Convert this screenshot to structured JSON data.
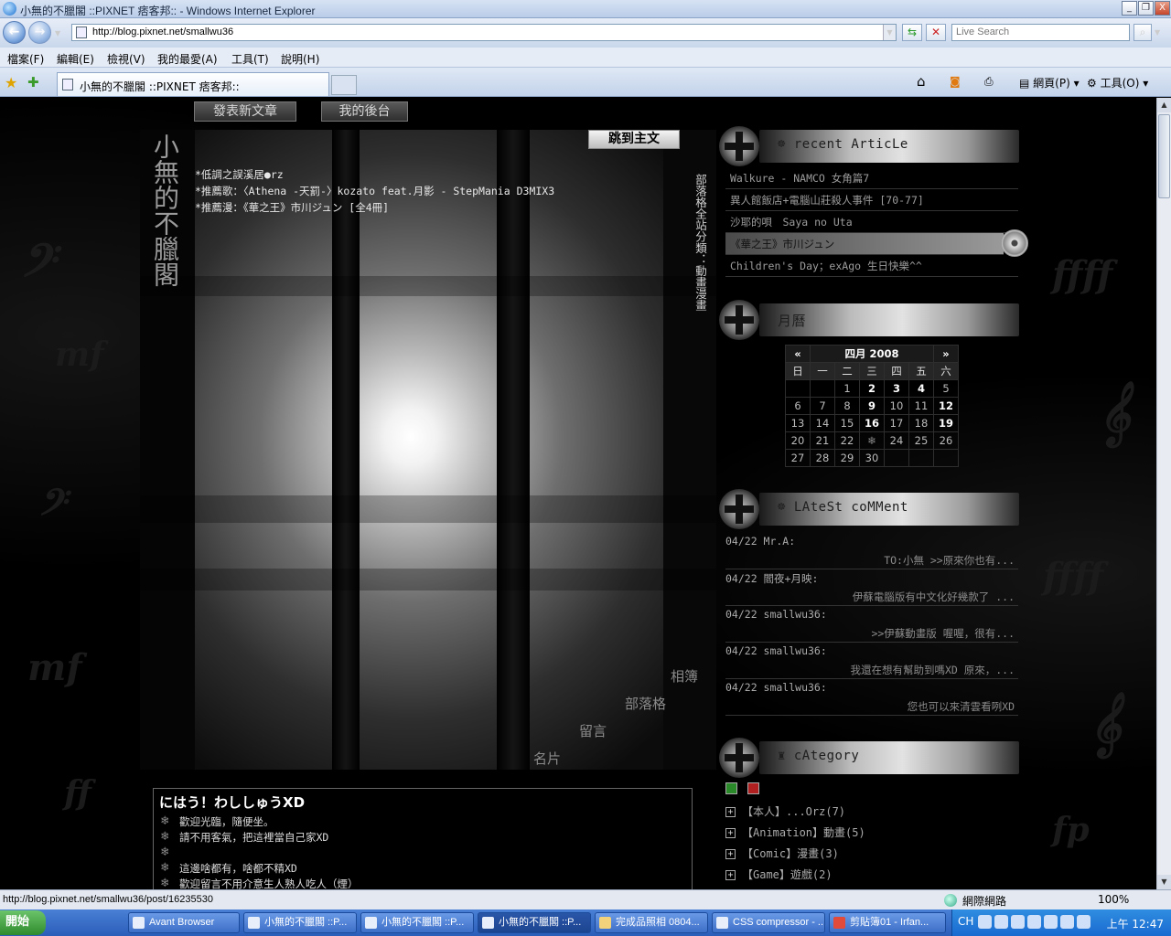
{
  "window": {
    "title": "小無的不臘閣 ::PIXNET 痞客邦:: - Windows Internet Explorer",
    "minimize": "_",
    "restore": "❐",
    "close": "X"
  },
  "address": {
    "url": "http://blog.pixnet.net/smallwu36",
    "search_placeholder": "Live Search"
  },
  "menu": [
    "檔案(F)",
    "編輯(E)",
    "檢視(V)",
    "我的最愛(A)",
    "工具(T)",
    "說明(H)"
  ],
  "tabs": {
    "active": "小無的不臘閣 ::PIXNET 痞客邦::",
    "cmd_page": "網頁(P)",
    "cmd_tools": "工具(O)"
  },
  "blog": {
    "btn_new_post": "發表新文章",
    "btn_admin": "我的後台",
    "title": "小無的不臘閣",
    "jump": "跳到主文",
    "notes": [
      "*低調之誤溪居●rz",
      "*推薦歌：〈Athena -天罰-〉kozato feat.月影 - StepMania D3MIX3",
      "*推薦漫：《華之王》市川ジュン [全4冊]"
    ],
    "vertical": "部落格全站分類：動畫漫畫",
    "nav": {
      "album": "相簿",
      "blog": "部落格",
      "guestbook": "留言",
      "card": "名片"
    },
    "intro": {
      "title": "にはう！わししゅうXD",
      "lines": [
        "歡迎光臨，隨便坐。",
        "請不用客氣，把這裡當自己家XD",
        "",
        "這邊啥都有，啥都不精XD",
        "歡迎留言不用介意生人熟人吃人（煙）"
      ]
    }
  },
  "sidebar": {
    "recent": {
      "title": "recent ArticLe",
      "items": [
        "Walkure - NAMCO 女角篇7",
        "異人館飯店+電腦山莊殺人事件 [70-77]",
        "沙耶的唄　Saya no Uta",
        "《華之王》市川ジュン",
        "Children's Day；exAgo 生日快樂^^"
      ]
    },
    "calendar": {
      "title": "月曆",
      "prev": "«",
      "next": "»",
      "month": "四月 2008",
      "weekdays": [
        "日",
        "一",
        "二",
        "三",
        "四",
        "五",
        "六"
      ],
      "rows": [
        [
          "",
          "",
          "1",
          "2",
          "3",
          "4",
          "5"
        ],
        [
          "6",
          "7",
          "8",
          "9",
          "10",
          "11",
          "12"
        ],
        [
          "13",
          "14",
          "15",
          "16",
          "17",
          "18",
          "19"
        ],
        [
          "20",
          "21",
          "22",
          "❄",
          "24",
          "25",
          "26"
        ],
        [
          "27",
          "28",
          "29",
          "30",
          "",
          "",
          ""
        ]
      ]
    },
    "comments": {
      "title": "LAteSt coMMent",
      "items": [
        {
          "who": "04/22 Mr.A:",
          "text": "TO:小無 >>原來你也有..."
        },
        {
          "who": "04/22 閻夜+月映:",
          "text": "伊蘇電腦版有中文化好幾款了 ..."
        },
        {
          "who": "04/22 smallwu36:",
          "text": ">>伊蘇動畫版 喔喔，很有..."
        },
        {
          "who": "04/22 smallwu36:",
          "text": "我還在想有幫助到嗎XD 原來，..."
        },
        {
          "who": "04/22 smallwu36:",
          "text": "您也可以來清雲看咧XD"
        }
      ]
    },
    "category": {
      "title": "cAtegory",
      "items": [
        "【本人】...Orz(7)",
        "【Animation】動畫(5)",
        "【Comic】漫畫(3)",
        "【Game】遊戲(2)"
      ]
    }
  },
  "status": {
    "url": "http://blog.pixnet.net/smallwu36/post/16235530",
    "zone": "網際網路",
    "zoom": "100%"
  },
  "taskbar": {
    "start": "開始",
    "tasks": [
      "Avant Browser",
      "小無的不臘閣 ::P...",
      "小無的不臘閣 ::P...",
      "小無的不臘閣 ::P...",
      "完成品照相 0804...",
      "CSS compressor - ...",
      "剪貼簿01 - Irfan..."
    ],
    "lang": "CH",
    "clock": "上午 12:47"
  },
  "colors": {
    "ie_blue": "#1a6fd0",
    "page_bg": "#000000",
    "taskbar": "#2a5db8"
  }
}
